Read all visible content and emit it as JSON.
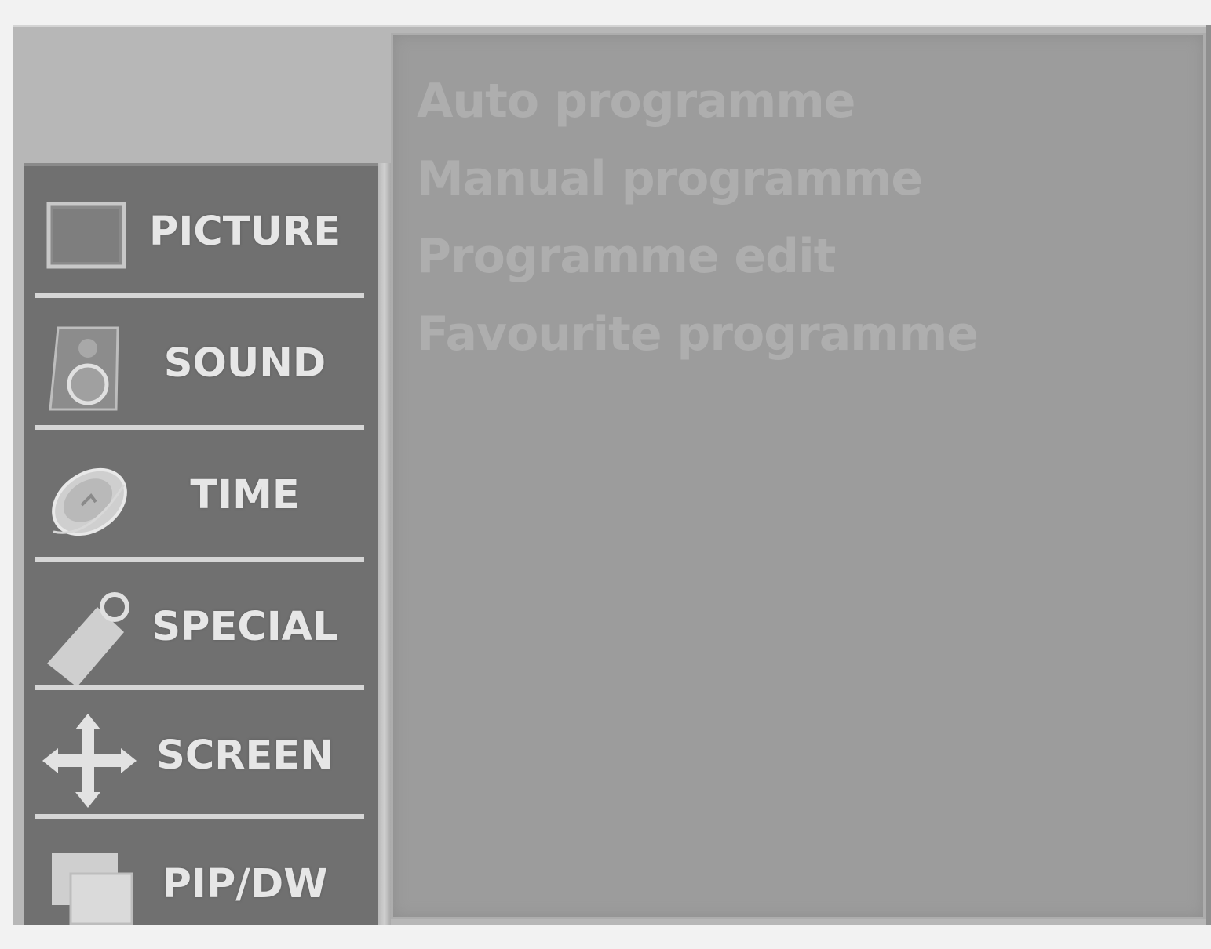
{
  "sidebar": {
    "items": [
      {
        "label": "PICTURE",
        "icon": "picture-icon"
      },
      {
        "label": "SOUND",
        "icon": "speaker-icon"
      },
      {
        "label": "TIME",
        "icon": "clock-icon"
      },
      {
        "label": "SPECIAL",
        "icon": "tag-icon"
      },
      {
        "label": "SCREEN",
        "icon": "move-arrows-icon"
      },
      {
        "label": "PIP/DW",
        "icon": "pip-icon"
      }
    ]
  },
  "submenu": {
    "items": [
      {
        "label": "Auto programme"
      },
      {
        "label": "Manual programme"
      },
      {
        "label": "Programme edit"
      },
      {
        "label": "Favourite programme"
      }
    ]
  },
  "colors": {
    "sidebar_bg": "#707070",
    "panel_bg": "#9c9c9c",
    "label_text": "#e6e6e6",
    "submenu_text": "#aeaeae"
  }
}
